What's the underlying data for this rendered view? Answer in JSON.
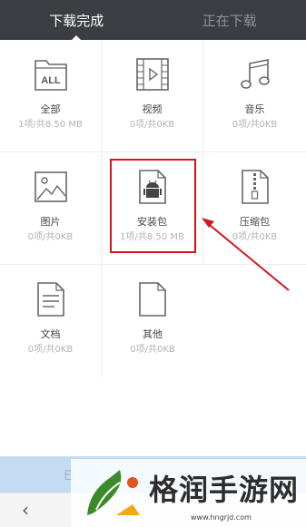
{
  "tabs": [
    {
      "label": "下载完成",
      "active": true
    },
    {
      "label": "正在下载",
      "active": false
    }
  ],
  "categories": [
    {
      "name": "全部",
      "meta": "1项/共8.50 MB",
      "icon": "folder-all-icon",
      "icon_text": "ALL"
    },
    {
      "name": "视频",
      "meta": "0项/共0KB",
      "icon": "video-film-icon"
    },
    {
      "name": "音乐",
      "meta": "0项/共0KB",
      "icon": "music-note-icon"
    },
    {
      "name": "图片",
      "meta": "0项/共0KB",
      "icon": "image-icon"
    },
    {
      "name": "安装包",
      "meta": "1项/共8.50 MB",
      "icon": "android-package-icon"
    },
    {
      "name": "压缩包",
      "meta": "0项/共0KB",
      "icon": "zip-archive-icon"
    },
    {
      "name": "文档",
      "meta": "0项/共0KB",
      "icon": "document-icon"
    },
    {
      "name": "其他",
      "meta": "0项/共0KB",
      "icon": "blank-file-icon"
    }
  ],
  "highlighted_category": "安装包",
  "bottom_bar": {
    "text": "已"
  },
  "nav": {
    "back_glyph": "‹"
  },
  "watermark": {
    "title": "格润手游网",
    "url": "www.hngrjd.com"
  },
  "colors": {
    "accent_red": "#d0161e",
    "tabbar_bg": "#3a3d42",
    "bottom_bar_bg": "#c3dcf2"
  }
}
